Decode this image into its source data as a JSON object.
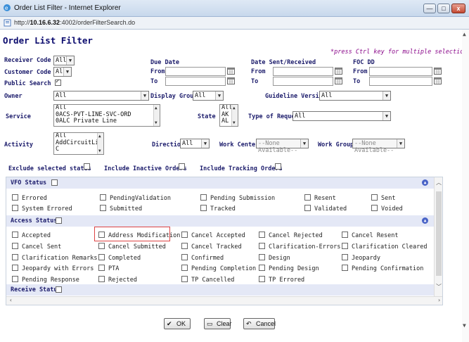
{
  "window": {
    "title": "Order List Filter - Internet Explorer",
    "url_prefix": "http://",
    "url_host": "10.16.6.32",
    "url_rest": ":4002/orderFilterSearch.do",
    "minimize": "—",
    "maximize": "□",
    "close": "x"
  },
  "page": {
    "heading": "Order List Filter",
    "note": "*press Ctrl key for multiple selections"
  },
  "filters": {
    "receiver_code": {
      "label": "Receiver Code",
      "value": "All"
    },
    "customer_code": {
      "label": "Customer Code",
      "value": "All"
    },
    "public_search": {
      "label": "Public Search",
      "checked": true
    },
    "due_date": {
      "label": "Due Date",
      "from": "From",
      "to": "To"
    },
    "date_sent": {
      "label": "Date Sent/Received",
      "from": "From",
      "to": "To"
    },
    "foc_dd": {
      "label": "FOC DD",
      "from": "From",
      "to": "To"
    },
    "owner": {
      "label": "Owner",
      "value": "All"
    },
    "display_group": {
      "label": "Display Group",
      "value": "All"
    },
    "guideline_version": {
      "label": "Guideline Version",
      "value": "All"
    },
    "service": {
      "label": "Service",
      "options": [
        "All",
        "0ACS-PVT-LINE-SVC-ORD",
        "0ALC Private Line"
      ]
    },
    "state": {
      "label": "State",
      "options": [
        "All",
        "AK",
        "AL"
      ]
    },
    "type_of_request": {
      "label": "Type of Request",
      "value": "All"
    },
    "activity": {
      "label": "Activity",
      "options": [
        "All",
        "AddCircuitList",
        "C"
      ]
    },
    "direction": {
      "label": "Direction",
      "value": "All"
    },
    "work_centers": {
      "label": "Work Centers",
      "value": "--None Available--"
    },
    "work_groups": {
      "label": "Work Groups",
      "value": "--None Available--"
    },
    "exclude_selected": "Exclude selected status",
    "include_inactive": "Include Inactive Orders",
    "include_tracking": "Include Tracking Orders"
  },
  "vfo_status": {
    "title": "VFO Status",
    "items": [
      "Errored",
      "PendingValidation",
      "Pending Submission",
      "Resent",
      "Sent",
      "System Errored",
      "Submitted",
      "Tracked",
      "Validated",
      "Voided"
    ]
  },
  "access_status": {
    "title": "Access Status",
    "items": [
      "Accepted",
      "Address Modification",
      "Cancel Accepted",
      "Cancel Rejected",
      "Cancel Resent",
      "Cancel Sent",
      "Cancel Submitted",
      "Cancel Tracked",
      "Clarification-Errors",
      "Clarification Cleared",
      "Clarification Remarks",
      "Completed",
      "Confirmed",
      "Design",
      "Jeopardy",
      "Jeopardy with Errors",
      "PTA",
      "Pending Completion",
      "Pending Design",
      "Pending Confirmation",
      "Pending Response",
      "Rejected",
      "TP Cancelled",
      "TP Errored"
    ]
  },
  "receive_status": {
    "title": "Receive Status"
  },
  "buttons": {
    "ok": "OK",
    "clear": "Clear",
    "cancel": "Cancel"
  }
}
